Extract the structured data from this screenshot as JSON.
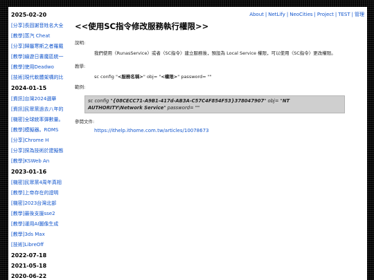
{
  "sidebar": {
    "groups": [
      {
        "date": "2025-02-20",
        "items": [
          {
            "cat": "[分享]",
            "title": "長固謝音姓名大全"
          },
          {
            "cat": "[教學]",
            "title": "蒸汽 Cheat"
          },
          {
            "cat": "[分享]",
            "title": "歸屬寒斯之者羅戴"
          },
          {
            "cat": "[教學]",
            "title": "繪遊日書魔區統一"
          },
          {
            "cat": "[教學]",
            "title": "使用Deadwo"
          },
          {
            "cat": "[技術]",
            "title": "現代軟體架構的比"
          }
        ]
      },
      {
        "date": "2024-01-15",
        "items": [
          {
            "cat": "[資訊]",
            "title": "台灣2024選舉"
          },
          {
            "cat": "[資訊]",
            "title": "民眾黨過去八年的"
          },
          {
            "cat": "[機密]",
            "title": "全球統率彈數量。"
          },
          {
            "cat": "[教學]",
            "title": "模擬器。ROMS"
          },
          {
            "cat": "[分享]",
            "title": "Chrome H"
          },
          {
            "cat": "[分享]",
            "title": "探為技術於建擬態"
          },
          {
            "cat": "[教學]",
            "title": "KSWeb An"
          }
        ]
      },
      {
        "date": "2023-01-16",
        "items": [
          {
            "cat": "[機密]",
            "title": "民眾黨4周年真相"
          },
          {
            "cat": "[教學]",
            "title": "上帝存在的證明"
          },
          {
            "cat": "[機密]",
            "title": "2023台灣北部"
          },
          {
            "cat": "[教學]",
            "title": "最後支援sse2"
          },
          {
            "cat": "[教學]",
            "title": "運用AI圖像生成"
          },
          {
            "cat": "[教學]",
            "title": "3ds Max"
          },
          {
            "cat": "[技術]",
            "title": "LibreOff"
          }
        ]
      },
      {
        "date": "2022-07-18",
        "items": []
      },
      {
        "date": "2021-05-18",
        "items": []
      },
      {
        "date": "2020-06-22",
        "items": []
      }
    ]
  },
  "nav": {
    "items": [
      "About",
      "NetLify",
      "NeoCities",
      "Project",
      "TEST",
      "管理"
    ]
  },
  "article": {
    "title": "<<使用SC指令修改服務執行權限>>",
    "desc_label": "說明:",
    "desc_text": "我們使用〈RunasService〉或者〈SC指令〉建立服務後，預設為 Local Service 權限，可以使用〈SC指令〉更改權限。",
    "teach_label": "教學:",
    "teach_cmd_prefix": "sc config \"",
    "teach_cmd_service": "<服務名稱>",
    "teach_cmd_mid": "\" obj= \"",
    "teach_cmd_perm": "<權限>",
    "teach_cmd_suffix": "\" password= \"\"",
    "example_label": "範例:",
    "example_line1_prefix": "sc config \"",
    "example_line1_guid": "{08CECC71-A9B1-417d-AB3A-C57C4F854F53}378047907",
    "example_line1_mid": "\" obj= \"",
    "example_line1_nt": "NT",
    "example_line2_auth": "AUTHORITY\\Network Service",
    "example_line2_suffix": "\" password= \"\"",
    "ref_label": "參閱文件:",
    "ref_url": "https://ithelp.ithome.com.tw/articles/10078673"
  },
  "colors": {
    "link": "#1155cc",
    "code_bg": "#cfcfcf",
    "page_bg": "#ffffff",
    "outer_bg": "#000000"
  }
}
